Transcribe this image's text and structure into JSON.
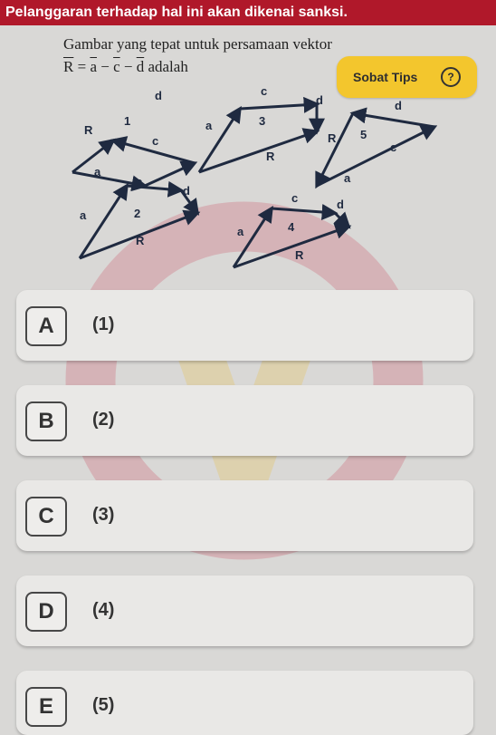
{
  "banner": {
    "text": "Pelanggaran terhadap hal ini akan dikenai sanksi."
  },
  "question": {
    "line1": "Gambar yang tepat untuk persamaan vektor",
    "formula_lhs": "R",
    "formula_eq": " = ",
    "formula_a": "a",
    "formula_minus1": " − ",
    "formula_c": "c",
    "formula_minus2": " − ",
    "formula_d": "d",
    "formula_tail": " adalah"
  },
  "tips": {
    "label": "Sobat Tips",
    "icon": "?"
  },
  "figures": [
    {
      "num": "1",
      "labels": {
        "R": "R",
        "a": "a",
        "c": "c",
        "d": "d"
      }
    },
    {
      "num": "3",
      "labels": {
        "R": "R",
        "a": "a",
        "c": "c",
        "d": "d"
      }
    },
    {
      "num": "5",
      "labels": {
        "R": "R",
        "a": "a",
        "c": "c",
        "d": "d"
      }
    },
    {
      "num": "2",
      "labels": {
        "R": "R",
        "a": "a",
        "c": "c",
        "d": "d"
      }
    },
    {
      "num": "4",
      "labels": {
        "R": "R",
        "a": "a",
        "c": "c",
        "d": "d"
      }
    }
  ],
  "options": [
    {
      "letter": "A",
      "text": "(1)"
    },
    {
      "letter": "B",
      "text": "(2)"
    },
    {
      "letter": "C",
      "text": "(3)"
    },
    {
      "letter": "D",
      "text": "(4)"
    },
    {
      "letter": "E",
      "text": "(5)"
    }
  ]
}
